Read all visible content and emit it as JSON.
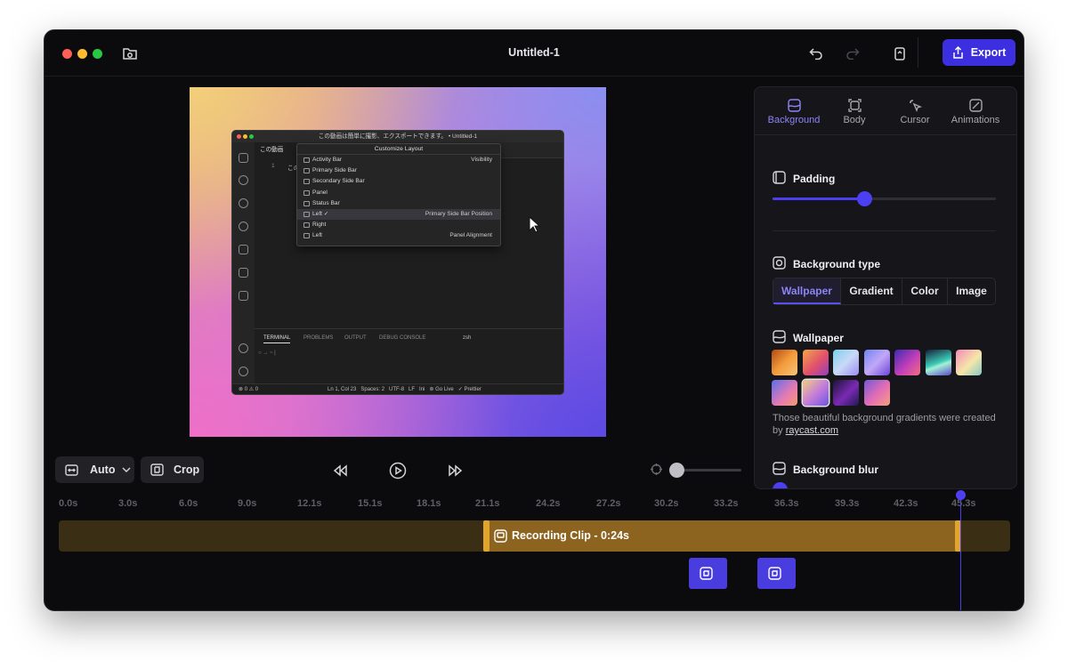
{
  "window": {
    "title": "Untitled-1",
    "export_label": "Export",
    "accent": "#3b2fe0"
  },
  "preview": {
    "vscode_title": "この動画は簡単に撮影、エクスポートできます。 • Untitled-1",
    "tab_label": "この動画",
    "line_number": "1",
    "line_text": "この",
    "menu_title": "Customize Layout",
    "menu_items": [
      {
        "label": "Activity Bar",
        "right": "Visibility"
      },
      {
        "label": "Primary Side Bar",
        "right": ""
      },
      {
        "label": "Secondary Side Bar",
        "right": ""
      },
      {
        "label": "Panel",
        "right": ""
      },
      {
        "label": "Status Bar",
        "right": ""
      },
      {
        "label": "Left ✓",
        "right": "Primary Side Bar Position"
      },
      {
        "label": "Right",
        "right": ""
      },
      {
        "label": "Left",
        "right": "Panel Alignment"
      }
    ],
    "panel_tabs": [
      "TERMINAL",
      "PROBLEMS",
      "OUTPUT",
      "DEBUG CONSOLE"
    ],
    "terminal_shell": "zsh",
    "terminal_prompt": "○ → ~ |",
    "status_left": "⊗ 0 ⚠ 0",
    "status_right": "Ln 1, Col 23   Spaces: 2   UTF-8   LF   Ini   ⊚ Go Live   ✓ Prettier"
  },
  "controls": {
    "aspect_label": "Auto",
    "crop_label": "Crop"
  },
  "panel": {
    "tabs": [
      {
        "label": "Background",
        "active": true
      },
      {
        "label": "Body",
        "active": false
      },
      {
        "label": "Cursor",
        "active": false
      },
      {
        "label": "Animations",
        "active": false
      }
    ],
    "padding": {
      "title": "Padding",
      "value": 0.41
    },
    "background_type": {
      "title": "Background type",
      "options": [
        "Wallpaper",
        "Gradient",
        "Color",
        "Image"
      ],
      "selected": "Wallpaper"
    },
    "wallpaper": {
      "title": "Wallpaper",
      "selected_index": 8,
      "credit_text": "Those beautiful background gradients were created by ",
      "credit_link": "raycast.com"
    },
    "blur": {
      "title": "Background blur",
      "value": 0.03
    }
  },
  "timeline": {
    "ticks": [
      "0.0s",
      "3.0s",
      "6.0s",
      "9.0s",
      "12.1s",
      "15.1s",
      "18.1s",
      "21.1s",
      "24.2s",
      "27.2s",
      "30.2s",
      "33.2s",
      "36.3s",
      "39.3s",
      "42.3s",
      "45.3s"
    ],
    "clip_label": "Recording Clip - 0:24s",
    "clip_color": "#8c6420"
  }
}
